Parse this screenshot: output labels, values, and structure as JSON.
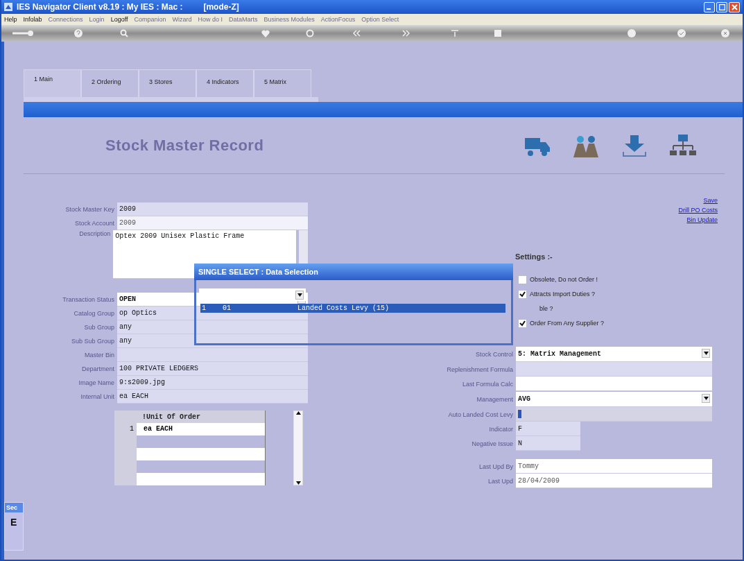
{
  "window": {
    "title": "IES Navigator Client v8.19 : My IES : Mac :",
    "mode": "[mode-Z]"
  },
  "menu": [
    {
      "label": "Help",
      "disabled": false
    },
    {
      "label": "Infolab",
      "disabled": false
    },
    {
      "label": "Connections",
      "disabled": true
    },
    {
      "label": "Login",
      "disabled": true
    },
    {
      "label": "Logoff",
      "disabled": false
    },
    {
      "label": "Companion",
      "disabled": true
    },
    {
      "label": "Wizard",
      "disabled": true
    },
    {
      "label": "How do I",
      "disabled": true
    },
    {
      "label": "DataMarts",
      "disabled": true
    },
    {
      "label": "Business Modules",
      "disabled": true
    },
    {
      "label": "ActionFocus",
      "disabled": true
    },
    {
      "label": "Option Select",
      "disabled": true
    }
  ],
  "toolbar": [
    {
      "kind": "key"
    },
    {
      "kind": "help"
    },
    {
      "kind": "search"
    },
    {
      "kind": "heart"
    },
    {
      "kind": "refresh"
    },
    {
      "kind": "prev"
    },
    {
      "kind": "next"
    },
    {
      "kind": "top"
    },
    {
      "kind": "stop"
    },
    {
      "kind": "cancel"
    },
    {
      "kind": "ok"
    },
    {
      "kind": "close"
    }
  ],
  "tabs": [
    {
      "label": "1 Main",
      "selected": true
    },
    {
      "label": "2 Ordering",
      "selected": false
    },
    {
      "label": "3 Stores",
      "selected": false
    },
    {
      "label": "4 Indicators",
      "selected": false
    },
    {
      "label": "5 Matrix",
      "selected": false
    }
  ],
  "form_title": "Stock Master Record",
  "left_fields": [
    {
      "label": "Stock Master Key",
      "value": "2009",
      "kind": "text"
    },
    {
      "label": "Stock Account",
      "value": "2009",
      "kind": "faded"
    },
    {
      "label": "Description",
      "value": "Optex 2009 Unisex Plastic Frame",
      "kind": "memo"
    },
    {
      "label": "Transaction Status",
      "value": "OPEN",
      "kind": "select"
    },
    {
      "label": "Catalog Group",
      "value": "op Optics",
      "kind": "text"
    },
    {
      "label": "Sub Group",
      "value": "any",
      "kind": "text"
    },
    {
      "label": "Sub Sub Group",
      "value": "any",
      "kind": "text"
    },
    {
      "label": "Master Bin",
      "kind": "text"
    },
    {
      "label": "Department",
      "value": "100 PRIVATE LEDGERS",
      "kind": "text"
    },
    {
      "label": "Image Name",
      "value": "9:s2009.jpg",
      "kind": "text"
    },
    {
      "label": "Internal Unit",
      "value": "ea EACH",
      "kind": "text"
    }
  ],
  "unit_grid": {
    "header": "!Unit Of Order",
    "rows": [
      {
        "number": "1",
        "value": "ea EACH"
      }
    ]
  },
  "links": [
    "Save",
    "Drill PO Costs",
    "Bin Update"
  ],
  "settings": {
    "title": "Settings :-",
    "options": [
      {
        "kind": "checkbox",
        "label": "Obsolete, Do not Order !",
        "checked": false
      },
      {
        "kind": "checkbox",
        "label": "Attracts Import Duties ?",
        "checked": true
      },
      {
        "kind": "covered",
        "label": "ble ?"
      },
      {
        "kind": "checkbox",
        "label": "Order From Any Supplier ?",
        "checked": true
      }
    ]
  },
  "right_fields": [
    {
      "label": "Stock Control",
      "value": "5: Matrix Management",
      "kind": "select"
    },
    {
      "label": "Replenishment Formula",
      "kind": "text"
    },
    {
      "label": "Last Formula Calc",
      "kind": "white"
    },
    {
      "label": "Management",
      "value": "AVG",
      "kind": "select"
    },
    {
      "label": "Auto Landed Cost Levy",
      "kind": "cursor"
    },
    {
      "label": "Indicator",
      "value": "F",
      "kind": "short"
    },
    {
      "label": "Negative Issue",
      "value": "N",
      "kind": "short"
    },
    {
      "label": "Last Upd By",
      "value": "Tommy",
      "kind": "gapwhite"
    },
    {
      "label": "Last Upd",
      "value": "28/04/2009",
      "kind": "white"
    }
  ],
  "dialog": {
    "title": "SINGLE SELECT : Data Selection",
    "rows": [
      {
        "number": "1",
        "code": "01",
        "name": "Landed Costs Levy (15)",
        "selected": true
      }
    ]
  },
  "side_panel": {
    "title": "Sec",
    "text": "E"
  }
}
